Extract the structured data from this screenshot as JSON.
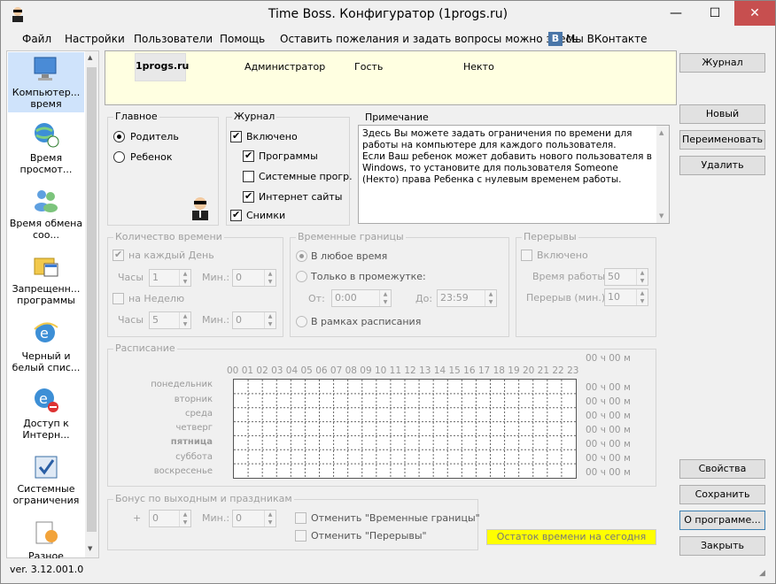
{
  "window": {
    "title": "Time Boss. Конфигуратор (1progs.ru)",
    "minimize": "—",
    "maximize": "☐",
    "close": "✕"
  },
  "menu": {
    "file": "Файл",
    "settings": "Настройки",
    "users": "Пользователи",
    "help": "Помощь",
    "feedback": "Оставить пожелания и задать вопросы можно здесь",
    "vk": "Мы ВКонтакте",
    "vk_logo": "В"
  },
  "sidebar": {
    "items": [
      {
        "label": "Компьютер... время",
        "icon": "computer-icon"
      },
      {
        "label": "Время просмот...",
        "icon": "globe-clock-icon"
      },
      {
        "label": "Время обмена соо...",
        "icon": "messenger-icon"
      },
      {
        "label": "Запрещенн... программы",
        "icon": "forbidden-programs-icon"
      },
      {
        "label": "Черный и белый спис...",
        "icon": "ie-list-icon"
      },
      {
        "label": "Доступ к Интерн...",
        "icon": "ie-blocked-icon"
      },
      {
        "label": "Системные ограничения",
        "icon": "system-restrictions-icon"
      },
      {
        "label": "Разное",
        "icon": "misc-icon"
      }
    ]
  },
  "users": [
    "1progs.ru",
    "Администратор",
    "Гость",
    "Некто"
  ],
  "main_group": {
    "title": "Главное",
    "parent": "Родитель",
    "child": "Ребенок"
  },
  "journal_group": {
    "title": "Журнал",
    "enabled": "Включено",
    "programs": "Программы",
    "system_progs": "Системные прогр.",
    "internet": "Интернет сайты",
    "screenshots": "Снимки"
  },
  "note": {
    "title": "Примечание",
    "text": "Здесь Вы можете задать ограничения по времени для работы на компьютере для каждого пользователя.\nЕсли Ваш ребенок может добавить нового пользователя в Windows, то установите для пользователя Someone (Некто) права Ребенка с нулевым временем работы."
  },
  "time_amount": {
    "title": "Количество времени",
    "every_day": "на каждый День",
    "hours": "Часы",
    "minutes": "Мин.:",
    "day_hours": "1",
    "day_min": "0",
    "per_week": "на Неделю",
    "week_hours": "5",
    "week_min": "0"
  },
  "time_bounds": {
    "title": "Временные границы",
    "any_time": "В любое время",
    "only_between": "Только в промежутке:",
    "from": "От:",
    "to": "До:",
    "from_val": "0:00",
    "to_val": "23:59",
    "schedule": "В рамках расписания"
  },
  "breaks": {
    "title": "Перерывы",
    "enabled": "Включено",
    "work_time": "Время работы",
    "break_time": "Перерыв (мин.):",
    "work_val": "50",
    "break_val": "10"
  },
  "schedule": {
    "title": "Расписание",
    "hours": "00 01 02 03 04 05 06 07 08 09 10 11 12 13 14 15 16 17 18 19 20 21 22 23",
    "total": "00 ч 00 м",
    "days": [
      "понедельник",
      "вторник",
      "среда",
      "четверг",
      "пятница",
      "суббота",
      "воскресенье"
    ],
    "values": [
      "00 ч 00 м",
      "00 ч 00 м",
      "00 ч 00 м",
      "00 ч 00 м",
      "00 ч 00 м",
      "00 ч 00 м",
      "00 ч 00 м"
    ]
  },
  "bonus": {
    "title": "Бонус по выходным и праздникам",
    "plus": "+",
    "hours_val": "0",
    "minutes": "Мин.:",
    "min_val": "0",
    "cancel_bounds": "Отменить \"Временные границы\"",
    "cancel_breaks": "Отменить \"Перерывы\""
  },
  "remaining": "Остаток времени на сегодня",
  "buttons": {
    "journal": "Журнал",
    "new": "Новый",
    "rename": "Переименовать",
    "delete": "Удалить",
    "properties": "Свойства",
    "save": "Сохранить",
    "about": "О программе...",
    "close": "Закрыть"
  },
  "version": "ver. 3.12.001.0"
}
